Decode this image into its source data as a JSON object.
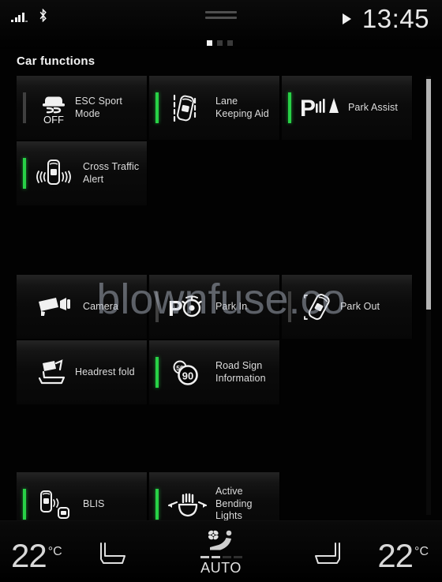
{
  "status_bar": {
    "signal_icon": "cellular-signal-icon",
    "bluetooth_icon": "bluetooth-icon",
    "play_icon": "media-play-icon",
    "time": "13:45",
    "page_dots": {
      "total": 3,
      "active_index": 0
    }
  },
  "header": {
    "title": "Car functions"
  },
  "watermark": {
    "text": "blownfuse.co"
  },
  "scrollbar": {
    "orientation": "vertical",
    "thumb_top_pct": 1,
    "thumb_height_pct": 52
  },
  "groups": [
    {
      "name": "driver-assistance-group",
      "tiles": [
        {
          "label": "ESC Sport Mode",
          "icon": "esc-off-icon",
          "state": "inactive",
          "col": 0,
          "row": 0
        },
        {
          "label": "Lane Keeping Aid",
          "icon": "lane-keeping-aid-icon",
          "state": "active",
          "col": 1,
          "row": 0
        },
        {
          "label": "Park Assist",
          "icon": "park-assist-icon",
          "state": "active",
          "col": 2,
          "row": 0
        },
        {
          "label": "Cross Traffic Alert",
          "icon": "cross-traffic-alert-icon",
          "state": "active",
          "col": 0,
          "row": 1
        }
      ]
    },
    {
      "name": "parking-camera-group",
      "tiles": [
        {
          "label": "Camera",
          "icon": "camera-icon",
          "state": "none",
          "col": 0,
          "row": 0
        },
        {
          "label": "Park In",
          "icon": "park-in-icon",
          "state": "inactive",
          "col": 1,
          "row": 0
        },
        {
          "label": "Park Out",
          "icon": "park-out-icon",
          "state": "inactive",
          "col": 2,
          "row": 0
        },
        {
          "label": "Headrest fold",
          "icon": "headrest-fold-icon",
          "state": "none",
          "col": 0,
          "row": 1
        },
        {
          "label": "Road Sign Information",
          "icon": "road-sign-info-icon",
          "state": "active",
          "col": 1,
          "row": 1
        }
      ]
    },
    {
      "name": "lighting-blind-spot-group",
      "tiles": [
        {
          "label": "BLIS",
          "icon": "blis-icon",
          "state": "active",
          "col": 0,
          "row": 0
        },
        {
          "label": "Active Bending Lights",
          "icon": "active-bending-lights-icon",
          "state": "active",
          "col": 1,
          "row": 0
        }
      ]
    }
  ],
  "climate_bar": {
    "left_temperature": "22",
    "left_temperature_unit": "°C",
    "right_temperature": "22",
    "right_temperature_unit": "°C",
    "left_seat_icon": "seat-heating-left-icon",
    "right_seat_icon": "seat-heating-right-icon",
    "auto_label": "AUTO",
    "auto_icon": "auto-climate-icon",
    "fan_segments": {
      "total": 4,
      "on": 2
    }
  },
  "colors": {
    "active_indicator": "#28d146",
    "inactive_indicator": "#3f3f3f",
    "text": "#dcdcdc",
    "background": "#000000"
  }
}
